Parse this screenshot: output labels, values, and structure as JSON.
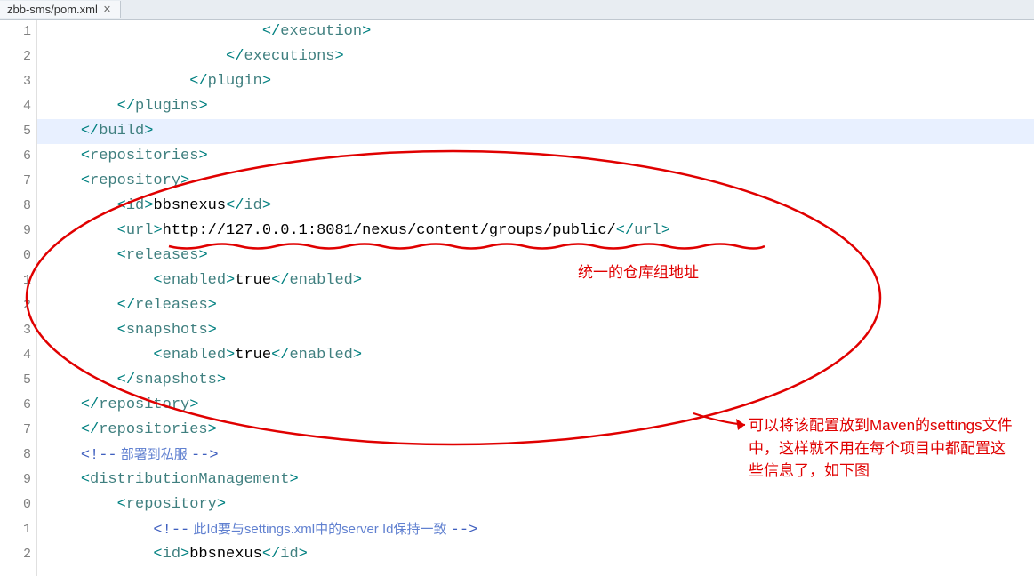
{
  "tab": {
    "filename": "zbb-sms/pom.xml",
    "close_icon": "✕"
  },
  "gutter": {
    "lines": [
      "1",
      "2",
      "3",
      "4",
      "5",
      "6",
      "7",
      "8",
      "9",
      "0",
      "1",
      "2",
      "3",
      "4",
      "5",
      "6",
      "7",
      "8",
      "9",
      "0",
      "1",
      "2"
    ]
  },
  "code": {
    "l1_indent": "                        ",
    "l1_open": "</",
    "l1_tag": "execution",
    "l1_close": ">",
    "l2_indent": "                    ",
    "l2_open": "</",
    "l2_tag": "executions",
    "l2_close": ">",
    "l3_indent": "                ",
    "l3_open": "</",
    "l3_tag": "plugin",
    "l3_close": ">",
    "l4_indent": "        ",
    "l4_open": "</",
    "l4_tag": "plugins",
    "l4_close": ">",
    "l5_indent": "    ",
    "l5_open": "</",
    "l5_tag": "build",
    "l5_close": ">",
    "l6_indent": "    ",
    "l6_open": "<",
    "l6_tag": "repositories",
    "l6_close": ">",
    "l7_indent": "    ",
    "l7_open": "<",
    "l7_tag": "repository",
    "l7_close": ">",
    "l8_indent": "        ",
    "l8_open": "<",
    "l8_tag": "id",
    "l8_close": ">",
    "l8_text": "bbsnexus",
    "l8_open2": "</",
    "l8_tag2": "id",
    "l8_close2": ">",
    "l9_indent": "        ",
    "l9_open": "<",
    "l9_tag": "url",
    "l9_close": ">",
    "l9_text": "http://127.0.0.1:8081/nexus/content/groups/public/",
    "l9_open2": "</",
    "l9_tag2": "url",
    "l9_close2": ">",
    "l10_indent": "        ",
    "l10_open": "<",
    "l10_tag": "releases",
    "l10_close": ">",
    "l11_indent": "            ",
    "l11_open": "<",
    "l11_tag": "enabled",
    "l11_close": ">",
    "l11_text": "true",
    "l11_open2": "</",
    "l11_tag2": "enabled",
    "l11_close2": ">",
    "l12_indent": "        ",
    "l12_open": "</",
    "l12_tag": "releases",
    "l12_close": ">",
    "l13_indent": "        ",
    "l13_open": "<",
    "l13_tag": "snapshots",
    "l13_close": ">",
    "l14_indent": "            ",
    "l14_open": "<",
    "l14_tag": "enabled",
    "l14_close": ">",
    "l14_text": "true",
    "l14_open2": "</",
    "l14_tag2": "enabled",
    "l14_close2": ">",
    "l15_indent": "        ",
    "l15_open": "</",
    "l15_tag": "snapshots",
    "l15_close": ">",
    "l16_indent": "    ",
    "l16_open": "</",
    "l16_tag": "repository",
    "l16_close": ">",
    "l17_indent": "    ",
    "l17_open": "</",
    "l17_tag": "repositories",
    "l17_close": ">",
    "l18_indent": "    ",
    "l18_open": "<!--",
    "l18_text": " 部署到私服 ",
    "l18_close": "-->",
    "l19_indent": "    ",
    "l19_open": "<",
    "l19_tag": "distributionManagement",
    "l19_close": ">",
    "l20_indent": "        ",
    "l20_open": "<",
    "l20_tag": "repository",
    "l20_close": ">",
    "l21_indent": "            ",
    "l21_open": "<!--",
    "l21_text": " 此Id要与settings.xml中的server Id保持一致 ",
    "l21_close": "-->",
    "l22_indent": "            ",
    "l22_open": "<",
    "l22_tag": "id",
    "l22_close": ">",
    "l22_text": "bbsnexus",
    "l22_open2": "</",
    "l22_tag2": "id",
    "l22_close2": ">"
  },
  "annotations": {
    "label1": "统一的仓库组地址",
    "label2": "可以将该配置放到Maven的settings文件中，这样就不用在每个项目中都配置这些信息了，如下图"
  }
}
